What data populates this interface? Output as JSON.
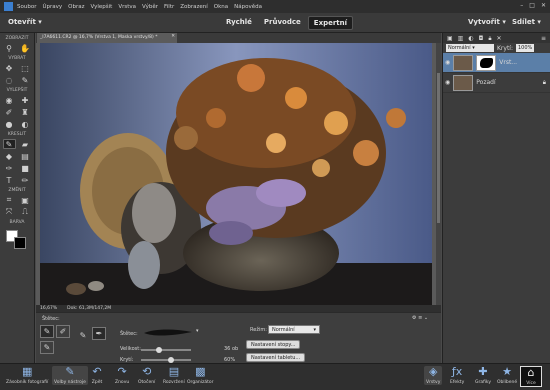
{
  "menubar": {
    "items": [
      "Soubor",
      "Úpravy",
      "Obraz",
      "Vylepšit",
      "Vrstva",
      "Výběr",
      "Filtr",
      "Zobrazení",
      "Okna",
      "Nápověda"
    ]
  },
  "modebar": {
    "open_label": "Otevřít",
    "modes": [
      "Rychlé",
      "Průvodce",
      "Expertní"
    ],
    "active_mode": "Expertní",
    "create_label": "Vytvořit",
    "share_label": "Sdílet"
  },
  "toolbox": {
    "sections": [
      "ZOBRAZIT",
      "VYBRAT",
      "VYLEPŠIT",
      "KRESLIT",
      "ZMĚNIT",
      "BARVA"
    ],
    "foreground_color": "#ffffff",
    "background_color": "#000000"
  },
  "document": {
    "tab_title": "_I7A6611.CR2 @ 16,7% (Vrstva 1, Maska vrstvy/8) *",
    "zoom": "16,67%",
    "doc_info": "Dok: 61,3M/147,2M"
  },
  "tool_options": {
    "brush_label": "Štětec:",
    "mode_label": "Režim:",
    "mode_value": "Normální",
    "size_label": "Velikost:",
    "size_value": "36 ob",
    "size_fraction": 0.35,
    "opacity_label": "Krytí:",
    "opacity_value": "60%",
    "opacity_fraction": 0.6,
    "brush_settings_button": "Nastavení stopy...",
    "tablet_settings_button": "Nastavení tabletu..."
  },
  "layers_panel": {
    "blend_mode": "Normální",
    "opacity_label": "Krytí:",
    "opacity_value": "100%",
    "layers": [
      {
        "name": "Vrst...",
        "selected": true
      },
      {
        "name": "Pozadí",
        "selected": false
      }
    ]
  },
  "taskbar": {
    "left": [
      "Zásobník fotografií",
      "Volby nástroje",
      "Zpět",
      "Znovu",
      "Otočení",
      "Rozvržení",
      "Organizátor"
    ],
    "right": [
      "Vrstvy",
      "Efekty",
      "Grafiky",
      "Oblíbené",
      "Více"
    ]
  },
  "colors": {
    "accent": "#3b7fd0",
    "selected_layer": "#5b7fa8"
  }
}
